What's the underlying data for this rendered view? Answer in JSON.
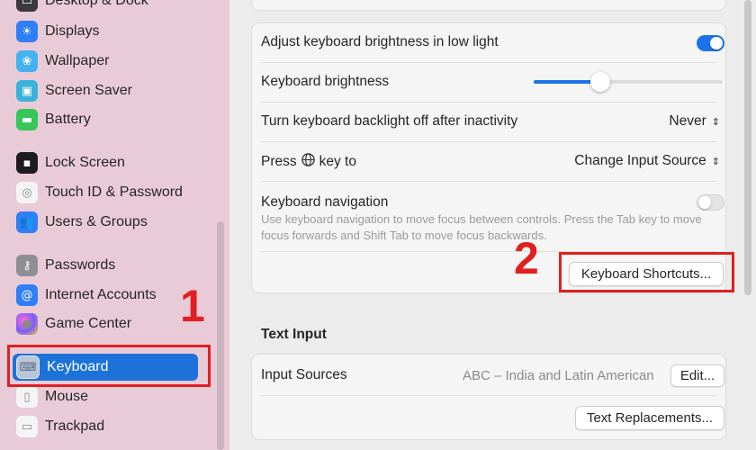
{
  "sidebar": {
    "items": [
      {
        "label": "Desktop & Dock",
        "icon": "desktop-dock-icon",
        "color": "#3a3a3c",
        "glyph": "▭"
      },
      {
        "label": "Displays",
        "icon": "displays-icon",
        "color": "#2f7ff5",
        "glyph": "☀"
      },
      {
        "label": "Wallpaper",
        "icon": "wallpaper-icon",
        "color": "#45b2f0",
        "glyph": "❀"
      },
      {
        "label": "Screen Saver",
        "icon": "screen-saver-icon",
        "color": "#3bb3d8",
        "glyph": "▣"
      },
      {
        "label": "Battery",
        "icon": "battery-icon",
        "color": "#35c759",
        "glyph": "▬"
      },
      {
        "label": "Lock Screen",
        "icon": "lock-screen-icon",
        "color": "#1c1c1e",
        "glyph": "▪"
      },
      {
        "label": "Touch ID & Password",
        "icon": "touch-id-icon",
        "color": "#f4f4f4",
        "glyph": "◎"
      },
      {
        "label": "Users & Groups",
        "icon": "users-groups-icon",
        "color": "#2f7ff5",
        "glyph": "👥"
      },
      {
        "label": "Passwords",
        "icon": "passwords-icon",
        "color": "#8e8e93",
        "glyph": "⚷"
      },
      {
        "label": "Internet Accounts",
        "icon": "internet-accounts-icon",
        "color": "#2f7ff5",
        "glyph": "@"
      },
      {
        "label": "Game Center",
        "icon": "game-center-icon",
        "color": "#ffffff",
        "glyph": "●"
      },
      {
        "label": "Keyboard",
        "icon": "keyboard-icon",
        "color": "#b9c6d8",
        "glyph": "⌨"
      },
      {
        "label": "Mouse",
        "icon": "mouse-icon",
        "color": "#f4f4f4",
        "glyph": "▯"
      },
      {
        "label": "Trackpad",
        "icon": "trackpad-icon",
        "color": "#f4f4f4",
        "glyph": "▭"
      }
    ]
  },
  "keyboard": {
    "adjust_brightness_label": "Adjust keyboard brightness in low light",
    "adjust_brightness_on": true,
    "brightness_label": "Keyboard brightness",
    "brightness_level": 0.35,
    "backlight_off_label": "Turn keyboard backlight off after inactivity",
    "backlight_off_value": "Never",
    "press_key_prefix": "Press",
    "press_key_suffix": "key to",
    "press_key_value": "Change Input Source",
    "nav_label": "Keyboard navigation",
    "nav_on": false,
    "nav_description": "Use keyboard navigation to move focus between controls. Press the Tab key to move focus forwards and Shift Tab to move focus backwards.",
    "shortcuts_button": "Keyboard Shortcuts..."
  },
  "text_input": {
    "section_title": "Text Input",
    "input_sources_label": "Input Sources",
    "input_sources_value": "ABC – India and Latin American",
    "edit_button": "Edit...",
    "text_replacements_button": "Text Replacements..."
  },
  "annotations": {
    "step1": "1",
    "step2": "2",
    "color": "#e02020"
  }
}
